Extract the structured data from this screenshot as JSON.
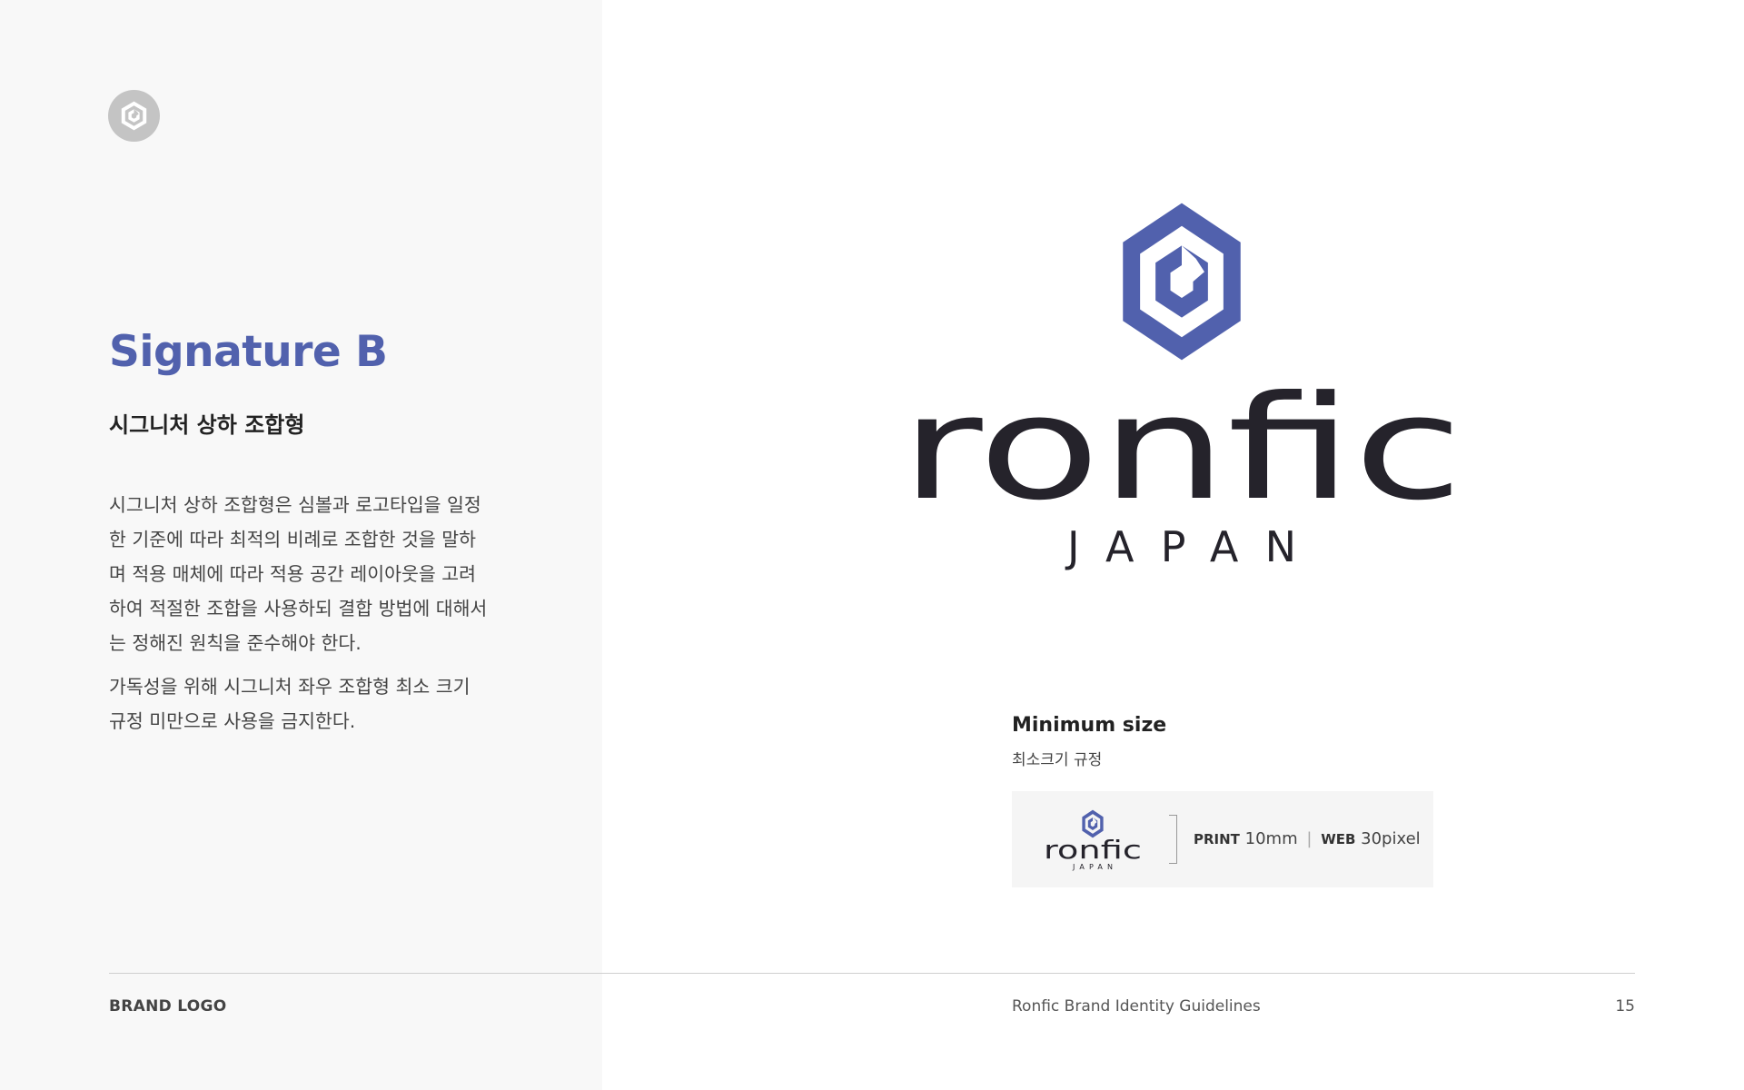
{
  "page": {
    "title": "Signature B",
    "subtitle": "시그니처 상하 조합형",
    "paragraphs": [
      "시그니처 상하 조합형은 심볼과 로고타입을 일정한 기준에 따라 최적의 비례로 조합한 것을 말하며 적용 매체에 따라 적용 공간 레이아웃을 고려하여 적절한 조합을 사용하되 결합 방법에 대해서는 정해진 원칙을 준수해야 한다.",
      "가독성을 위해 시그니처 좌우 조합형 최소 크기 규정 미만으로 사용을 금지한다."
    ]
  },
  "logo": {
    "wordmark": "ronfic",
    "tagline": "JAPAN",
    "symbol_icon": "hexagon-c-icon",
    "symbol_color": "#5161ad",
    "wordmark_color": "#25232b",
    "corner_icon_color": "#c4c4c4"
  },
  "minimum_size": {
    "title": "Minimum size",
    "subtitle": "최소크기 규정",
    "print_label": "PRINT",
    "print_value": "10mm",
    "separator": "|",
    "web_label": "WEB",
    "web_value": "30pixel"
  },
  "footer": {
    "section": "BRAND LOGO",
    "document_title": "Ronfic Brand Identity Guidelines",
    "page_number": "15"
  },
  "colors": {
    "accent": "#5161ad",
    "left_panel_bg": "#f8f8f8",
    "min_box_bg": "#f5f5f5"
  }
}
